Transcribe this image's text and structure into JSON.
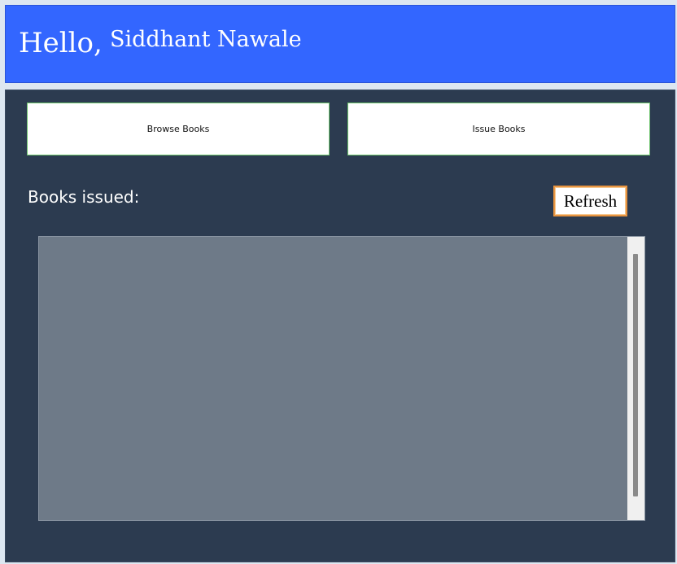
{
  "header": {
    "greeting": "Hello,",
    "username": "Siddhant Nawale"
  },
  "nav": {
    "browse_label": "Browse Books",
    "issue_label": "Issue Books"
  },
  "issued": {
    "label": "Books issued:",
    "refresh_label": "Refresh",
    "items": []
  },
  "colors": {
    "header_bg": "#3366ff",
    "main_bg": "#2c3b50",
    "list_bg": "#6e7a88",
    "button_border": "#6cc46c",
    "refresh_border": "#e89440"
  }
}
